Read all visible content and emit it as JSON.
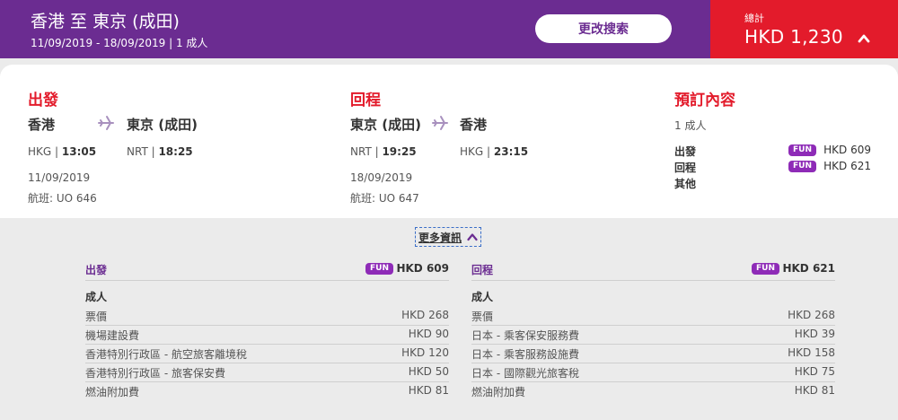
{
  "header": {
    "route_title": "香港 至 東京 (成田)",
    "trip_info": "11/09/2019 - 18/09/2019 | 1 成人",
    "modify_button": "更改搜索",
    "total_label": "總計",
    "total_amount": "HKD 1,230"
  },
  "outbound": {
    "title": "出發",
    "from_city": "香港",
    "to_city": "東京 (成田)",
    "from_code": "HKG",
    "from_time": "13:05",
    "to_code": "NRT",
    "to_time": "18:25",
    "date": "11/09/2019",
    "flight": "航班: UO 646"
  },
  "inbound": {
    "title": "回程",
    "from_city": "東京 (成田)",
    "to_city": "香港",
    "from_code": "NRT",
    "from_time": "19:25",
    "to_code": "HKG",
    "to_time": "23:15",
    "date": "18/09/2019",
    "flight": "航班: UO 647"
  },
  "booking": {
    "title": "預訂內容",
    "pax": "1 成人",
    "rows": [
      {
        "label": "出發",
        "fare": "FUN",
        "price": "HKD 609"
      },
      {
        "label": "回程",
        "fare": "FUN",
        "price": "HKD 621"
      },
      {
        "label": "其他",
        "fare": "",
        "price": ""
      }
    ]
  },
  "more_info": "更多資訊",
  "breakdown": {
    "outbound": {
      "title": "出發",
      "fare": "FUN",
      "total": "HKD 609",
      "adult_label": "成人",
      "items": [
        {
          "label": "票價",
          "value": "HKD 268"
        },
        {
          "label": "機場建設費",
          "value": "HKD 90"
        },
        {
          "label": "香港特別行政區 - 航空旅客離境稅",
          "value": "HKD 120"
        },
        {
          "label": "香港特別行政區 - 旅客保安費",
          "value": "HKD 50"
        },
        {
          "label": "燃油附加費",
          "value": "HKD 81"
        }
      ]
    },
    "inbound": {
      "title": "回程",
      "fare": "FUN",
      "total": "HKD 621",
      "adult_label": "成人",
      "items": [
        {
          "label": "票價",
          "value": "HKD 268"
        },
        {
          "label": "日本 - 乘客保安服務費",
          "value": "HKD 39"
        },
        {
          "label": "日本 - 乘客服務設施費",
          "value": "HKD 158"
        },
        {
          "label": "日本 - 國際觀光旅客稅",
          "value": "HKD 75"
        },
        {
          "label": "燃油附加費",
          "value": "HKD 81"
        }
      ]
    }
  },
  "colors": {
    "brand_purple": "#6b2c91",
    "total_red": "#e31b2b",
    "fun_badge": "#8e2bb7"
  },
  "icons": {
    "plane": "airplane-icon",
    "chevron": "chevron-up-icon"
  }
}
